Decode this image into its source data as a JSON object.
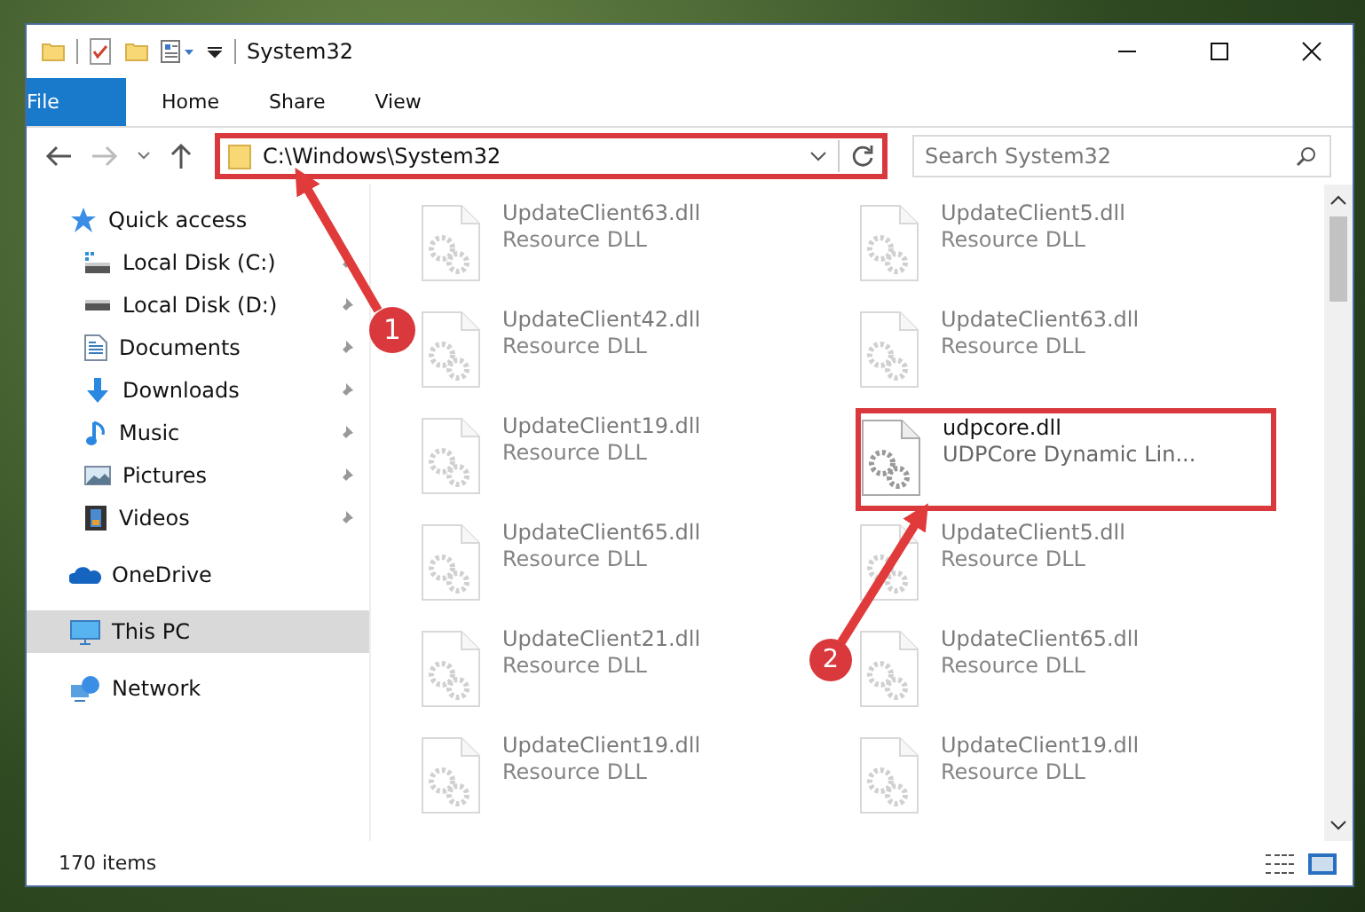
{
  "window": {
    "title": "System32"
  },
  "ribbon_tabs": [
    {
      "label": "File",
      "kind": "file"
    },
    {
      "label": "Home",
      "kind": "tab"
    },
    {
      "label": "Share",
      "kind": "tab"
    },
    {
      "label": "View",
      "kind": "tab"
    }
  ],
  "address_bar": {
    "path": "C:\\Windows\\System32",
    "highlighted": true
  },
  "search": {
    "placeholder": "Search System32"
  },
  "sidebar": {
    "items": [
      {
        "label": "Quick access",
        "kind": "star",
        "selected": false,
        "children": [
          {
            "label": "Local Disk (C:)",
            "kind": "system-drive",
            "pinned": true,
            "selected": false
          },
          {
            "label": "Local Disk (D:)",
            "kind": "drive",
            "pinned": true,
            "selected": false
          },
          {
            "label": "Documents",
            "kind": "documents",
            "pinned": true,
            "selected": false
          },
          {
            "label": "Downloads",
            "kind": "downloads",
            "pinned": true,
            "selected": false
          },
          {
            "label": "Music",
            "kind": "music",
            "pinned": true,
            "selected": false
          },
          {
            "label": "Pictures",
            "kind": "pictures",
            "pinned": true,
            "selected": false
          },
          {
            "label": "Videos",
            "kind": "videos",
            "pinned": true,
            "selected": false
          }
        ]
      },
      {
        "label": "OneDrive",
        "kind": "cloud",
        "selected": false
      },
      {
        "label": "This PC",
        "kind": "computer",
        "selected": true
      },
      {
        "label": "Network",
        "kind": "network",
        "selected": false
      }
    ]
  },
  "files": [
    {
      "name": "UpdateClient63.dll",
      "description": "Resource DLL",
      "faded": true,
      "highlighted": false
    },
    {
      "name": "UpdateClient5.dll",
      "description": "Resource DLL",
      "faded": true,
      "highlighted": false
    },
    {
      "name": "UpdateClient42.dll",
      "description": "Resource DLL",
      "faded": true,
      "highlighted": false
    },
    {
      "name": "UpdateClient63.dll",
      "description": "Resource DLL",
      "faded": true,
      "highlighted": false
    },
    {
      "name": "UpdateClient19.dll",
      "description": "Resource DLL",
      "faded": true,
      "highlighted": false
    },
    {
      "name": "udpcore.dll",
      "description": "UDPCore Dynamic Lin...",
      "faded": false,
      "highlighted": true
    },
    {
      "name": "UpdateClient65.dll",
      "description": "Resource DLL",
      "faded": true,
      "highlighted": false
    },
    {
      "name": "UpdateClient5.dll",
      "description": "Resource DLL",
      "faded": true,
      "highlighted": false
    },
    {
      "name": "UpdateClient21.dll",
      "description": "Resource DLL",
      "faded": true,
      "highlighted": false
    },
    {
      "name": "UpdateClient65.dll",
      "description": "Resource DLL",
      "faded": true,
      "highlighted": false
    },
    {
      "name": "UpdateClient19.dll",
      "description": "Resource DLL",
      "faded": true,
      "highlighted": false
    },
    {
      "name": "UpdateClient19.dll",
      "description": "Resource DLL",
      "faded": true,
      "highlighted": false
    }
  ],
  "status_bar": {
    "item_count": "170 items"
  },
  "annotations": [
    {
      "label": "1"
    },
    {
      "label": "2"
    }
  ]
}
